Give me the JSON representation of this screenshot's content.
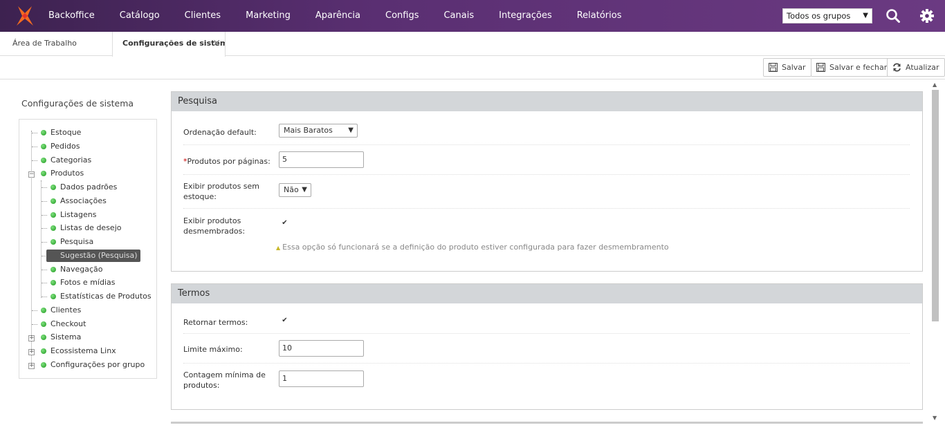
{
  "nav": {
    "items": [
      "Backoffice",
      "Catálogo",
      "Clientes",
      "Marketing",
      "Aparência",
      "Configs",
      "Canais",
      "Integrações",
      "Relatórios"
    ],
    "group_select": "Todos os grupos",
    "logo_icon": "linx-logo-icon",
    "search_icon": "search-icon",
    "settings_icon": "gear-icon"
  },
  "tabs": {
    "home": "Área de Trabalho",
    "active": "Configurações de sistem",
    "close": "✕"
  },
  "toolbar": {
    "save": "Salvar",
    "save_close": "Salvar e fechar",
    "refresh": "Atualizar"
  },
  "tree": {
    "title": "Configurações de sistema",
    "items": [
      {
        "label": "Estoque"
      },
      {
        "label": "Pedidos"
      },
      {
        "label": "Categorias"
      },
      {
        "label": "Produtos"
      },
      {
        "label": "Dados padrões"
      },
      {
        "label": "Associações"
      },
      {
        "label": "Listagens"
      },
      {
        "label": "Listas de desejo"
      },
      {
        "label": "Pesquisa"
      },
      {
        "label": "Sugestão (Pesquisa)"
      },
      {
        "label": "Navegação"
      },
      {
        "label": "Fotos e mídias"
      },
      {
        "label": "Estatísticas de Produtos"
      },
      {
        "label": "Clientes"
      },
      {
        "label": "Checkout"
      },
      {
        "label": "Sistema"
      },
      {
        "label": "Ecossistema Linx"
      },
      {
        "label": "Configurações por grupo"
      }
    ]
  },
  "pesquisa": {
    "title": "Pesquisa",
    "ordenacao_label": "Ordenação default:",
    "ordenacao_value": "Mais Baratos",
    "produtos_req": "*",
    "produtos_label": "Produtos por páginas:",
    "produtos_value": "5",
    "exibir_sem_estoque_label": "Exibir produtos sem estoque:",
    "exibir_sem_estoque_value": "Não",
    "desmembrados_label": "Exibir produtos desmembrados:",
    "desmembrados_checked": true,
    "hint": "Essa opção só funcionará se a definição do produto estiver configurada para fazer desmembramento"
  },
  "termos": {
    "title": "Termos",
    "retornar_label": "Retornar termos:",
    "retornar_checked": true,
    "limite_label": "Limite máximo:",
    "limite_value": "10",
    "contagem_label": "Contagem mínima de produtos:",
    "contagem_value": "1"
  },
  "check_mark": "✔",
  "dropdown_arrow": "▼"
}
